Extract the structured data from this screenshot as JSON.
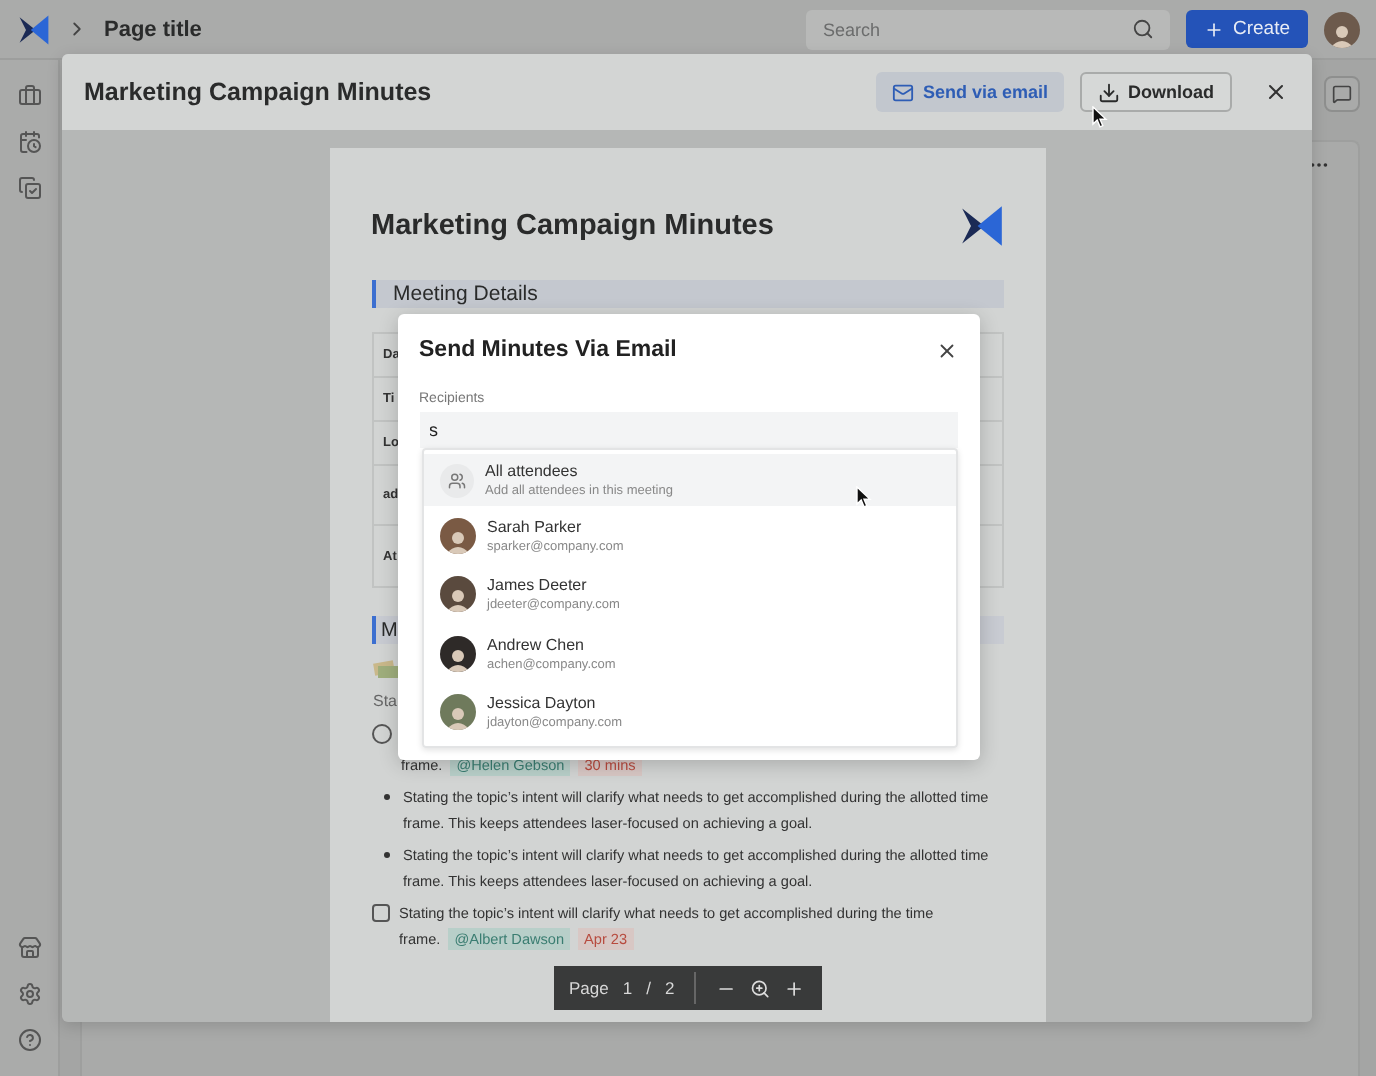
{
  "topbar": {
    "breadcrumb": "Page title",
    "search": {
      "placeholder": "Search"
    },
    "create_button": "Create"
  },
  "preview": {
    "title": "Marketing Campaign Minutes",
    "send_button": "Send via email",
    "download_button": "Download"
  },
  "document": {
    "title": "Marketing Campaign Minutes",
    "section": "Meeting Details",
    "detail_rows": [
      "Da",
      "Ti",
      "Lo",
      "ad",
      "At"
    ],
    "section_2": "M",
    "label": "Sta",
    "items": [
      {
        "kind": "circle_task",
        "checked": false,
        "text": "frame.",
        "tags": [
          {
            "kind": "mention",
            "text": "@Helen Gebson"
          },
          {
            "kind": "due",
            "text": "30 mins"
          }
        ]
      },
      {
        "kind": "bullet",
        "text": "Stating the topic’s intent will clarify what needs to get accomplished during the allotted time frame. This keeps attendees laser-focused on achieving a goal."
      },
      {
        "kind": "bullet",
        "text": "Stating the topic’s intent will clarify what needs to get accomplished during the allotted time frame. This keeps attendees laser-focused on achieving a goal."
      },
      {
        "kind": "check_task",
        "checked": false,
        "text": "Stating the topic’s intent will clarify what needs to get accomplished during the time frame.",
        "tags": [
          {
            "kind": "mention",
            "text": "@Albert Dawson"
          },
          {
            "kind": "due",
            "text": "Apr 23"
          }
        ]
      }
    ],
    "pager": {
      "label": "Page",
      "current": "1",
      "separator": "/",
      "total": "2"
    }
  },
  "dialog": {
    "title": "Send Minutes Via Email",
    "field_label": "Recipients",
    "value": "s",
    "options": [
      {
        "kind": "group",
        "name": "All attendees",
        "detail": "Add all attendees in this meeting",
        "selected": true
      },
      {
        "kind": "person",
        "name": "Sarah Parker",
        "detail": "sparker@company.com",
        "selected": false
      },
      {
        "kind": "person",
        "name": "James Deeter",
        "detail": "jdeeter@company.com",
        "selected": false
      },
      {
        "kind": "person",
        "name": "Andrew Chen",
        "detail": "achen@company.com",
        "selected": false
      },
      {
        "kind": "person",
        "name": "Jessica Dayton",
        "detail": "jdayton@company.com",
        "selected": false
      }
    ]
  }
}
